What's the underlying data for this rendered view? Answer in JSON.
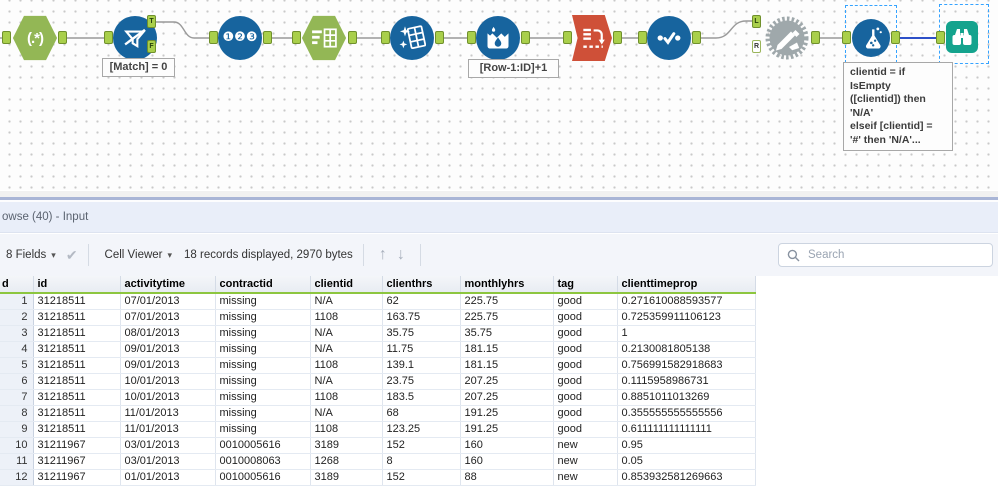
{
  "colors": {
    "tool_blue": "#17649e",
    "tool_green": "#93b755",
    "tool_red": "#cf5038",
    "tool_gray": "#9fa8ab",
    "browse_teal": "#14a38d",
    "anchor_green": "#a9cf4b",
    "header_underline_green": "#8dc63f",
    "selection_blue": "#35a3ff",
    "selected_wire_blue": "#2d50c8"
  },
  "canvas": {
    "tools": [
      {
        "name": "regex",
        "icon": "regex-icon",
        "label": "(.*)"
      },
      {
        "name": "filter",
        "icon": "filter-icon",
        "outputs": [
          "T",
          "F"
        ],
        "annotation": "[Match] = 0"
      },
      {
        "name": "record-id",
        "icon": "record-id-icon",
        "digits": "❶❷❸"
      },
      {
        "name": "select",
        "icon": "select-icon"
      },
      {
        "name": "data-cleansing",
        "icon": "data-cleansing-icon"
      },
      {
        "name": "multi-row-formula",
        "icon": "multi-row-formula-icon",
        "annotation": "[Row-1:ID]+1"
      },
      {
        "name": "transpose",
        "icon": "transpose-icon"
      },
      {
        "name": "unique",
        "icon": "unique-icon"
      },
      {
        "name": "macro",
        "icon": "macro-gear-icon",
        "inputs": [
          "L",
          "R"
        ]
      },
      {
        "name": "formula",
        "icon": "formula-icon",
        "selected": true,
        "annotation": "clientid = if\nIsEmpty\n([clientid]) then\n'N/A'\nelseif [clientid] =\n'#' then 'N/A'..."
      },
      {
        "name": "browse",
        "icon": "browse-icon",
        "selected": true
      }
    ]
  },
  "results_panel": {
    "title": "owse (40) - Input",
    "toolbar": {
      "fields_label": "8 Fields",
      "cell_viewer_label": "Cell Viewer",
      "records_label": "18 records displayed, 2970 bytes",
      "search_placeholder": "Search"
    }
  },
  "table": {
    "record_header": "d",
    "columns": [
      "id",
      "activitytime",
      "contractid",
      "clientid",
      "clienthrs",
      "monthlyhrs",
      "tag",
      "clienttimeprop"
    ],
    "rows": [
      {
        "num": "1",
        "cells": [
          "31218511",
          "07/01/2013",
          "missing",
          "N/A",
          "62",
          "225.75",
          "good",
          "0.271610088593577"
        ]
      },
      {
        "num": "2",
        "cells": [
          "31218511",
          "07/01/2013",
          "missing",
          "1108",
          "163.75",
          "225.75",
          "good",
          "0.725359911106123"
        ]
      },
      {
        "num": "3",
        "cells": [
          "31218511",
          "08/01/2013",
          "missing",
          "N/A",
          "35.75",
          "35.75",
          "good",
          "1"
        ]
      },
      {
        "num": "4",
        "cells": [
          "31218511",
          "09/01/2013",
          "missing",
          "N/A",
          "11.75",
          "181.15",
          "good",
          "0.2130081805138"
        ]
      },
      {
        "num": "5",
        "cells": [
          "31218511",
          "09/01/2013",
          "missing",
          "1108",
          "139.1",
          "181.15",
          "good",
          "0.756991582918683"
        ]
      },
      {
        "num": "6",
        "cells": [
          "31218511",
          "10/01/2013",
          "missing",
          "N/A",
          "23.75",
          "207.25",
          "good",
          "0.1115958986731"
        ]
      },
      {
        "num": "7",
        "cells": [
          "31218511",
          "10/01/2013",
          "missing",
          "1108",
          "183.5",
          "207.25",
          "good",
          "0.8851011013269"
        ]
      },
      {
        "num": "8",
        "cells": [
          "31218511",
          "11/01/2013",
          "missing",
          "N/A",
          "68",
          "191.25",
          "good",
          "0.355555555555556"
        ]
      },
      {
        "num": "9",
        "cells": [
          "31218511",
          "11/01/2013",
          "missing",
          "1108",
          "123.25",
          "191.25",
          "good",
          "0.611111111111111"
        ]
      },
      {
        "num": "10",
        "cells": [
          "31211967",
          "03/01/2013",
          "0010005616",
          "3189",
          "152",
          "160",
          "new",
          "0.95"
        ]
      },
      {
        "num": "11",
        "cells": [
          "31211967",
          "03/01/2013",
          "0010008063",
          "1268",
          "8",
          "160",
          "new",
          "0.05"
        ]
      },
      {
        "num": "12",
        "cells": [
          "31211967",
          "01/01/2013",
          "0010005616",
          "3189",
          "152",
          "88",
          "new",
          "0.853932581269663"
        ]
      }
    ]
  }
}
